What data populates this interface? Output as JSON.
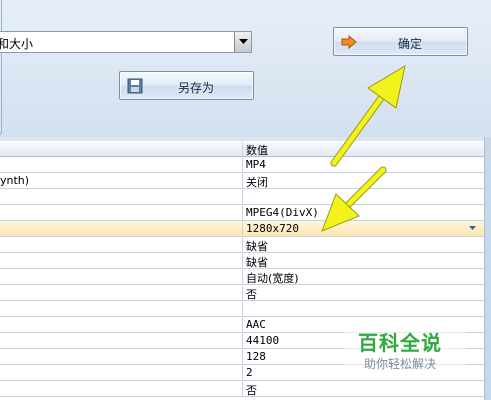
{
  "colors": {
    "panel": "#d9e5f3",
    "selected_row": "#fde7b0",
    "arrow": "#f2f21d",
    "watermark": "#2eaa3f"
  },
  "preset_combo": {
    "value": "和大小"
  },
  "buttons": {
    "ok_label": "确定",
    "ok_icon": "arrow-right-icon",
    "save_as_label": "另存为",
    "save_as_icon": "floppy-disk-icon"
  },
  "grid": {
    "value_header": "数值",
    "rows": [
      {
        "name": "",
        "value": "MP4"
      },
      {
        "name": "ynth)",
        "value": "关闭"
      },
      {
        "name": "",
        "value": ""
      },
      {
        "name": "",
        "value": "MPEG4(DivX)"
      },
      {
        "name": "",
        "value": "1280x720"
      },
      {
        "name": "",
        "value": "缺省"
      },
      {
        "name": "",
        "value": "缺省"
      },
      {
        "name": "",
        "value": "自动(宽度)"
      },
      {
        "name": "",
        "value": "否"
      },
      {
        "name": "",
        "value": ""
      },
      {
        "name": "",
        "value": "AAC"
      },
      {
        "name": "",
        "value": "44100"
      },
      {
        "name": "",
        "value": "128"
      },
      {
        "name": "",
        "value": "2"
      },
      {
        "name": "",
        "value": "否"
      }
    ]
  },
  "watermark": {
    "title": "百科全说",
    "subtitle": "助你轻松解决"
  }
}
